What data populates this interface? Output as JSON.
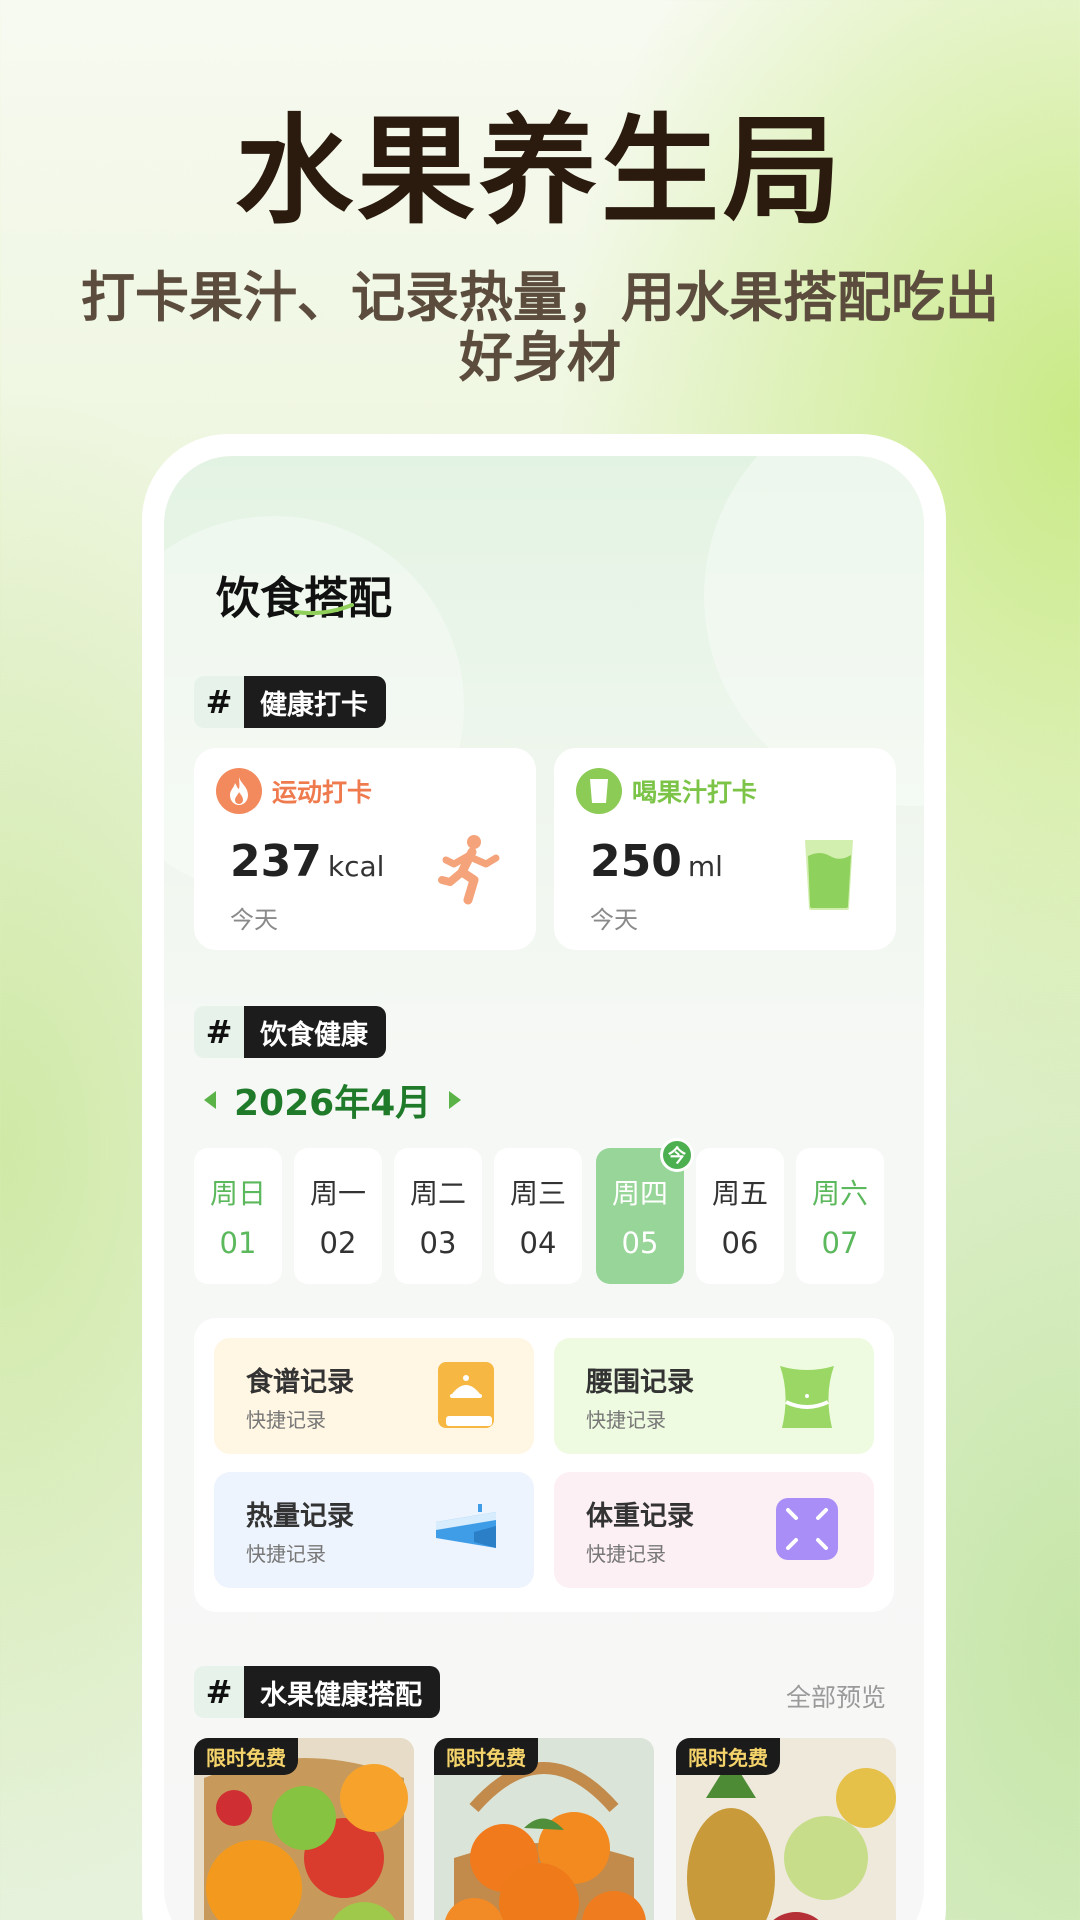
{
  "hero": {
    "title": "水果养生局",
    "subtitle": "打卡果汁、记录热量，用水果搭配吃出好身材"
  },
  "screen": {
    "title": "饮食搭配",
    "sections": {
      "checkin": "健康打卡",
      "diet": "饮食健康",
      "fruit": "水果健康搭配"
    },
    "checkins": [
      {
        "title": "运动打卡",
        "value": "237",
        "unit": "kcal",
        "period": "今天",
        "icon": "fire-icon",
        "color": "#ef7a4e"
      },
      {
        "title": "喝果汁打卡",
        "value": "250",
        "unit": "ml",
        "period": "今天",
        "icon": "juice-cup-icon",
        "color": "#7cc448"
      }
    ],
    "calendar": {
      "month": "2026年4月",
      "today_badge": "今",
      "days": [
        {
          "weekday": "周日",
          "day": "01"
        },
        {
          "weekday": "周一",
          "day": "02"
        },
        {
          "weekday": "周二",
          "day": "03"
        },
        {
          "weekday": "周三",
          "day": "04"
        },
        {
          "weekday": "周四",
          "day": "05"
        },
        {
          "weekday": "周五",
          "day": "06"
        },
        {
          "weekday": "周六",
          "day": "07"
        }
      ]
    },
    "tools": [
      {
        "title": "食谱记录",
        "sub": "快捷记录",
        "icon": "recipe-book-icon",
        "bg": "#fff6e3"
      },
      {
        "title": "腰围记录",
        "sub": "快捷记录",
        "icon": "waist-icon",
        "bg": "#eefbe0"
      },
      {
        "title": "热量记录",
        "sub": "快捷记录",
        "icon": "cake-icon",
        "bg": "#eef4fd"
      },
      {
        "title": "体重记录",
        "sub": "快捷记录",
        "icon": "scale-icon",
        "bg": "#fdf0f5"
      }
    ],
    "see_all": "全部预览",
    "fruit_cards": [
      {
        "badge": "限时免费"
      },
      {
        "badge": "限时免费"
      },
      {
        "badge": "限时免费"
      }
    ]
  }
}
